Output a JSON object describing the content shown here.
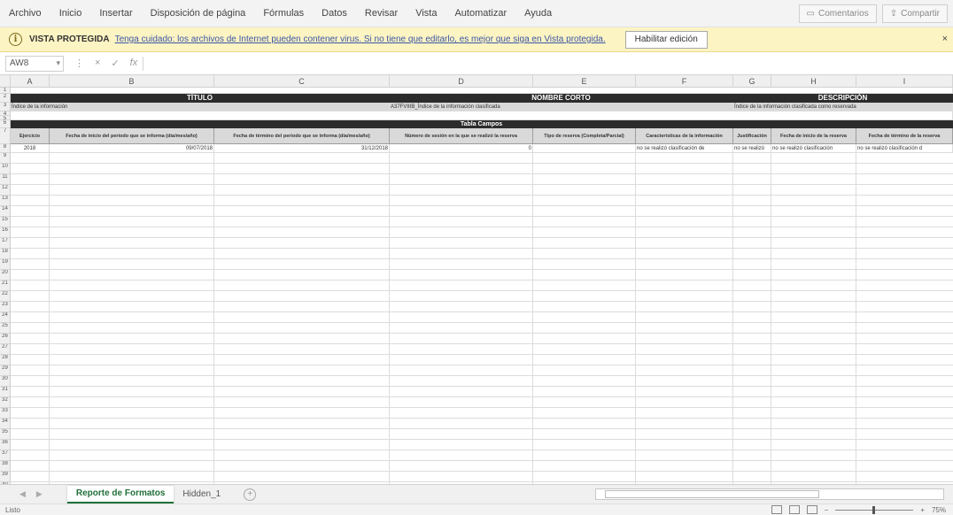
{
  "menu": {
    "items": [
      "Archivo",
      "Inicio",
      "Insertar",
      "Disposición de página",
      "Fórmulas",
      "Datos",
      "Revisar",
      "Vista",
      "Automatizar",
      "Ayuda"
    ],
    "comments": "Comentarios",
    "share": "Compartir"
  },
  "protected_view": {
    "title": "VISTA PROTEGIDA",
    "message": "Tenga cuidado: los archivos de Internet pueden contener virus. Si no tiene que editarlo, es mejor que siga en Vista protegida.",
    "enable_button": "Habilitar edición"
  },
  "formula_bar": {
    "name_box": "AW8",
    "fx": "fx",
    "cancel": "×",
    "confirm": "✓"
  },
  "columns": [
    "A",
    "B",
    "C",
    "D",
    "E",
    "F",
    "G",
    "H",
    "I"
  ],
  "rows": [
    "1",
    "2",
    "3",
    "4",
    "5",
    "6",
    "7",
    "8",
    "9",
    "10",
    "11",
    "12",
    "13",
    "14",
    "15",
    "16",
    "17",
    "18",
    "19",
    "20",
    "21",
    "22",
    "23",
    "24",
    "25",
    "26",
    "27",
    "28",
    "29",
    "30",
    "31",
    "32",
    "33",
    "34",
    "35",
    "36",
    "37",
    "38",
    "39",
    "40"
  ],
  "sheet": {
    "row2": {
      "titulo": "TÍTULO",
      "nombre_corto": "NOMBRE CORTO",
      "descripcion": "DESCRIPCIÓN"
    },
    "row3": {
      "titulo": "Índice de la información",
      "nombre_corto": "A37FVIIIB_Índice de la información clasificada",
      "descripcion": "Índice de la información clasificada como reservada"
    },
    "row6": {
      "label": "Tabla Campos"
    },
    "row7": {
      "a": "Ejercicio",
      "b": "Fecha de inicio del periodo que se informa (día/mes/año)",
      "c": "Fecha de término del periodo que se informa (día/mes/año)",
      "d": "Número de sesión en la que se realizó la reserva",
      "e": "Tipo de reserva (Completa/Parcial)",
      "f": "Características de la información",
      "g": "Justificación",
      "h": "Fecha de inicio de la reserva",
      "i": "Fecha de término de la reserva"
    },
    "row8": {
      "a": "2018",
      "b": "09/07/2018",
      "c": "31/12/2018",
      "d": "0",
      "e": "",
      "f": "no se realizó clasificación de",
      "g": "no se realizó",
      "h": "no se realizó clasificación",
      "i": "no se realizó clasificación d"
    }
  },
  "tabs": {
    "active": "Reporte de Formatos",
    "other": "Hidden_1",
    "add": "+"
  },
  "status": {
    "left": "Listo",
    "zoom": "75%"
  }
}
